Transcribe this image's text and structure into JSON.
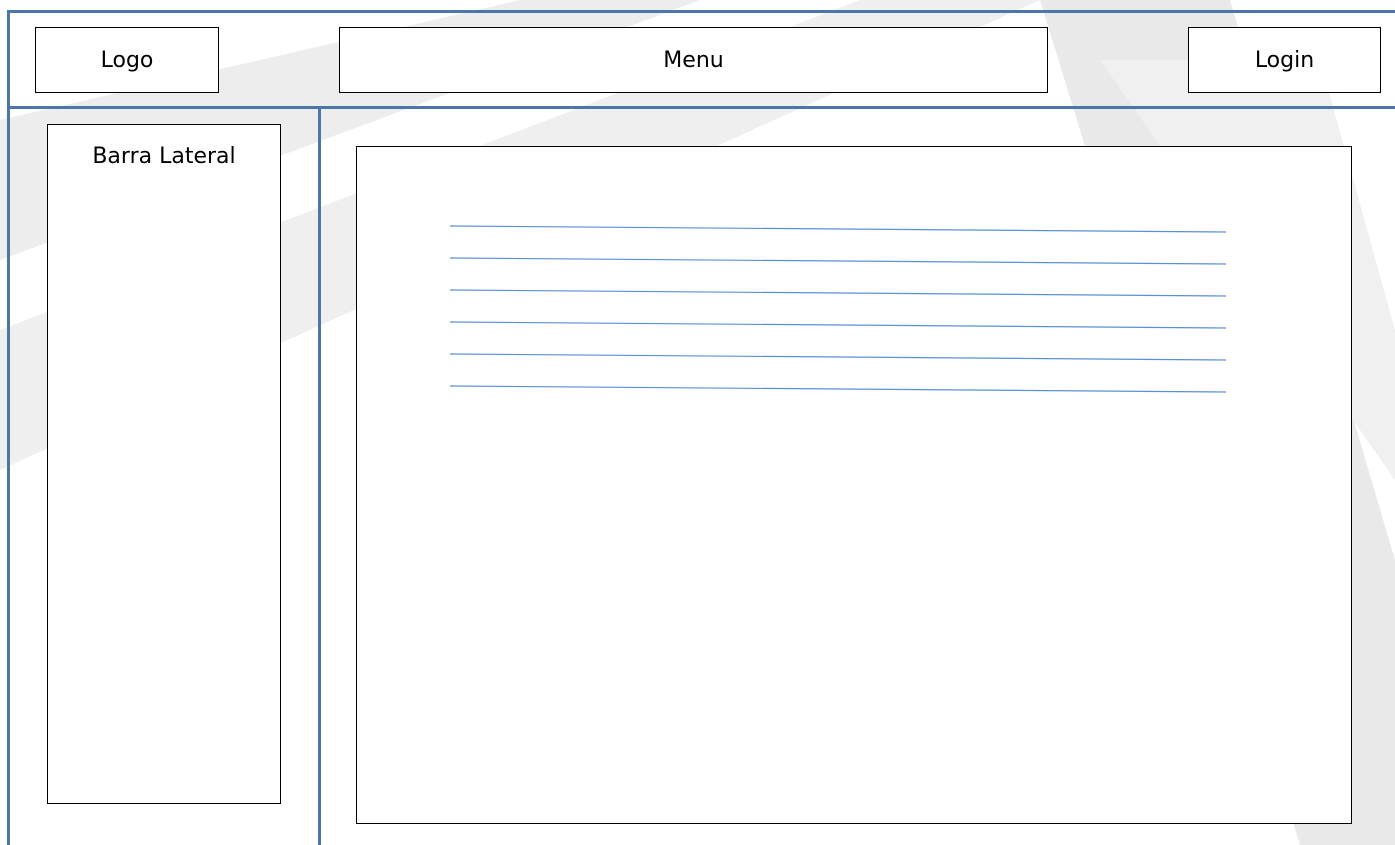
{
  "header": {
    "logo_label": "Logo",
    "menu_label": "Menu",
    "login_label": "Login"
  },
  "sidebar": {
    "title": "Barra Lateral"
  },
  "main": {
    "text_line_count": 6
  },
  "colors": {
    "frame": "#4a76a8",
    "text_lines": "#5b8fd6",
    "box_border": "#000000",
    "watermark": "#ebebeb"
  }
}
